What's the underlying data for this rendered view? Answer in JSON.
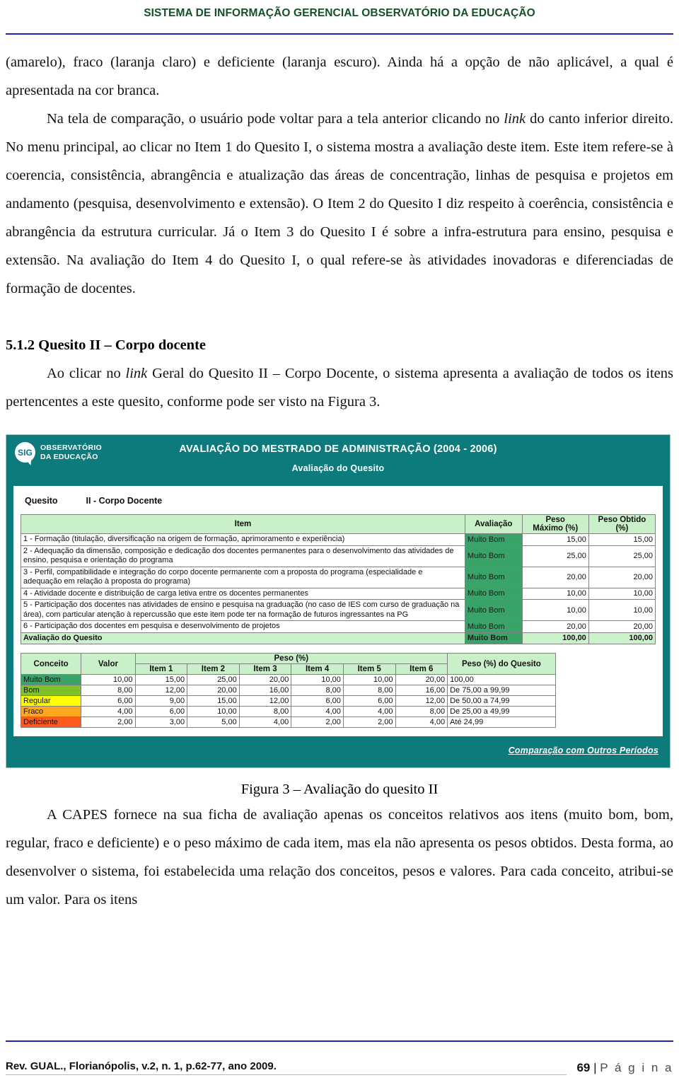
{
  "page_header": {
    "title": "SISTEMA DE INFORMAÇÃO GERENCIAL OBSERVATÓRIO DA EDUCAÇÃO"
  },
  "body": {
    "para1_a": "(amarelo), fraco (laranja claro) e deficiente (laranja escuro). Ainda há a opção de não aplicável, a qual é apresentada na cor branca.",
    "para2_a": "Na tela de comparação, o usuário pode voltar para a tela anterior clicando no ",
    "para2_link": "link",
    "para2_b": " do canto inferior direito. No menu principal, ao clicar no Item 1 do Quesito I, o sistema mostra a avaliação deste item. Este item refere-se à coerencia, consistência, abrangência e atualização das áreas de concentração, linhas de pesquisa e projetos em andamento (pesquisa, desenvolvimento e extensão). O Item 2 do Quesito I diz respeito à coerência, consistência e abrangência da estrutura curricular. Já o Item 3 do Quesito I é sobre a infra-estrutura para ensino, pesquisa e extensão. Na avaliação do Item 4 do Quesito I, o qual refere-se às atividades inovadoras e diferenciadas de formação de docentes.",
    "section_title": "5.1.2 Quesito II – Corpo docente",
    "para3_a": "Ao clicar no ",
    "para3_link": "link",
    "para3_b": " Geral do Quesito II – Corpo Docente, o sistema apresenta a avaliação de todos os itens pertencentes a este quesito, conforme pode ser visto na Figura 3.",
    "figure_caption": "Figura 3 – Avaliação do quesito II",
    "para4": "A CAPES fornece na sua ficha de avaliação apenas os conceitos relativos aos itens (muito bom, bom, regular, fraco e deficiente) e o peso máximo de cada item, mas ela não apresenta os pesos obtidos. Desta forma, ao desenvolver o sistema, foi estabelecida uma relação dos conceitos, pesos e valores. Para cada conceito, atribui-se um valor. Para os itens"
  },
  "figure": {
    "logo": {
      "badge": "SIG",
      "line1": "OBSERVATÓRIO",
      "line2": "DA EDUCAÇÃO"
    },
    "app_title": "AVALIAÇÃO DO MESTRADO DE ADMINISTRAÇÃO (2004 - 2006)",
    "app_subtitle": "Avaliação do Quesito",
    "quesito_label": "Quesito",
    "quesito_value": "II - Corpo Docente",
    "main_table": {
      "headers": [
        "Item",
        "Avaliação",
        "Peso Máximo (%)",
        "Peso Obtido (%)"
      ],
      "header_peso_max_l1": "Peso",
      "header_peso_max_l2": "Máximo (%)",
      "header_peso_obt_l1": "Peso Obtido",
      "header_peso_obt_l2": "(%)",
      "rows": [
        {
          "item": "1 - Formação (titulação, diversificação na origem de formação, aprimoramento e experiência)",
          "avaliacao": "Muito Bom",
          "peso_maximo": "15,00",
          "peso_obtido": "15,00"
        },
        {
          "item": "2 - Adequação da dimensão, composição e dedicação dos docentes permanentes para o desenvolvimento das atividades de ensino, pesquisa e orientação do programa",
          "avaliacao": "Muito Bom",
          "peso_maximo": "25,00",
          "peso_obtido": "25,00"
        },
        {
          "item": "3 - Perfil, compatibilidade e integração do corpo docente permanente com a proposta do programa (especialidade e adequação em relação à proposta do programa)",
          "avaliacao": "Muito Bom",
          "peso_maximo": "20,00",
          "peso_obtido": "20,00"
        },
        {
          "item": "4 - Atividade docente e distribuição de carga letiva entre os docentes permanentes",
          "avaliacao": "Muito Bom",
          "peso_maximo": "10,00",
          "peso_obtido": "10,00"
        },
        {
          "item": "5 - Participação dos docentes nas atividades de ensino e pesquisa na graduação (no caso de IES com curso de graduação na área), com particular atenção à repercussão que este item pode ter na formação de futuros ingressantes na PG",
          "avaliacao": "Muito Bom",
          "peso_maximo": "10,00",
          "peso_obtido": "10,00"
        },
        {
          "item": "6 - Participação dos docentes em pesquisa e desenvolvimento de projetos",
          "avaliacao": "Muito Bom",
          "peso_maximo": "20,00",
          "peso_obtido": "20,00"
        }
      ],
      "total": {
        "item": "Avaliação do Quesito",
        "avaliacao": "Muito Bom",
        "peso_maximo": "100,00",
        "peso_obtido": "100,00"
      }
    },
    "legend_table": {
      "header_conceito": "Conceito",
      "header_valor": "Valor",
      "header_peso_group": "Peso (%)",
      "header_items": [
        "Item 1",
        "Item 2",
        "Item 3",
        "Item 4",
        "Item 5",
        "Item 6"
      ],
      "header_quesito": "Peso (%) do Quesito",
      "rows": [
        {
          "conceito": "Muito Bom",
          "color": "#3aa36a",
          "valor": "10,00",
          "pesos": [
            "15,00",
            "25,00",
            "20,00",
            "10,00",
            "10,00",
            "20,00"
          ],
          "quesito": "100,00"
        },
        {
          "conceito": "Bom",
          "color": "#7ec22a",
          "valor": "8,00",
          "pesos": [
            "12,00",
            "20,00",
            "16,00",
            "8,00",
            "8,00",
            "16,00"
          ],
          "quesito": "De 75,00 a 99,99"
        },
        {
          "conceito": "Regular",
          "color": "#ffff00",
          "valor": "6,00",
          "pesos": [
            "9,00",
            "15,00",
            "12,00",
            "6,00",
            "6,00",
            "12,00"
          ],
          "quesito": "De 50,00 a 74,99"
        },
        {
          "conceito": "Fraco",
          "color": "#ffa51e",
          "valor": "4,00",
          "pesos": [
            "6,00",
            "10,00",
            "8,00",
            "4,00",
            "4,00",
            "8,00"
          ],
          "quesito": "De 25,00 a 49,99"
        },
        {
          "conceito": "Deficiente",
          "color": "#ff5a1e",
          "valor": "2,00",
          "pesos": [
            "3,00",
            "5,00",
            "4,00",
            "2,00",
            "2,00",
            "4,00"
          ],
          "quesito": "Até 24,99"
        }
      ]
    },
    "compare_link": "Comparação com Outros Períodos"
  },
  "footer": {
    "reference": "Rev. GUAL., Florianópolis, v.2, n. 1, p.62-77, ano 2009.",
    "page_number": "69",
    "page_word": "P á g i n a",
    "separator": "|"
  },
  "colors": {
    "header_green": "#16502b",
    "rule_blue": "#2020c8",
    "app_teal": "#0d7b7b",
    "table_header_green": "#c9f0c9",
    "eval_green": "#3aa36a"
  }
}
